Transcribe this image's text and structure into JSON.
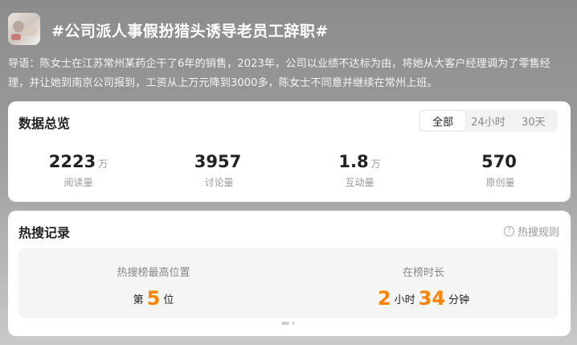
{
  "topic": {
    "title": "#公司派人事假扮猎头诱导老员工辞职#",
    "lead": "导语：陈女士在江苏常州某药企干了6年的销售，2023年，公司以业绩不达标为由，将她从大客户经理调为了零售经理，并让她到南京公司报到，工资从上万元降到3000多，陈女士不同意并继续在常州上班。"
  },
  "overview": {
    "title": "数据总览",
    "tabs": [
      "全部",
      "24小时",
      "30天"
    ],
    "active_tab": "全部",
    "stats": [
      {
        "value": "2223",
        "unit": "万",
        "label": "阅读量"
      },
      {
        "value": "3957",
        "unit": "",
        "label": "讨论量"
      },
      {
        "value": "1.8",
        "unit": "万",
        "label": "互动量"
      },
      {
        "value": "570",
        "unit": "",
        "label": "原创量"
      }
    ]
  },
  "hot": {
    "title": "热搜记录",
    "rules_label": "热搜规则",
    "rules_icon": "question-circle-icon",
    "peak": {
      "caption": "热搜榜最高位置",
      "prefix": "第",
      "value": "5",
      "suffix": "位"
    },
    "duration": {
      "caption": "在榜时长",
      "hours": "2",
      "hours_unit": "小时",
      "minutes": "34",
      "minutes_unit": "分钟"
    }
  },
  "colors": {
    "accent": "#ff8200"
  }
}
